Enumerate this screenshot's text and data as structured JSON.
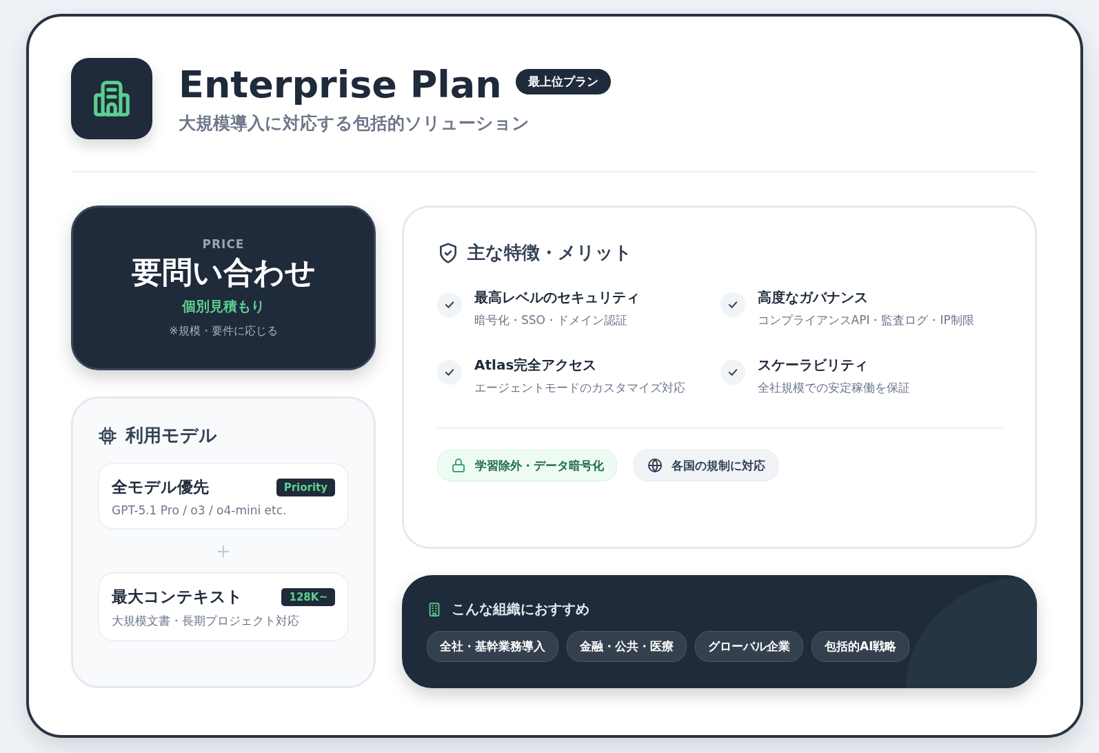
{
  "header": {
    "title": "Enterprise Plan",
    "badge": "最上位プラン",
    "subtitle": "大規模導入に対応する包括的ソリューション"
  },
  "price": {
    "label": "PRICE",
    "value": "要問い合わせ",
    "note": "個別見積もり",
    "subnote": "※規模・要件に応じる"
  },
  "models": {
    "title": "利用モデル",
    "separator": "+",
    "items": [
      {
        "name": "全モデル優先",
        "tag": "Priority",
        "desc": "GPT-5.1 Pro / o3 / o4-mini etc."
      },
      {
        "name": "最大コンテキスト",
        "tag": "128K~",
        "desc": "大規模文書・長期プロジェクト対応"
      }
    ]
  },
  "features": {
    "title": "主な特徴・メリット",
    "items": [
      {
        "title": "最高レベルのセキュリティ",
        "desc": "暗号化・SSO・ドメイン認証"
      },
      {
        "title": "高度なガバナンス",
        "desc": "コンプライアンスAPI・監査ログ・IP制限"
      },
      {
        "title": "Atlas完全アクセス",
        "desc": "エージェントモードのカスタマイズ対応"
      },
      {
        "title": "スケーラビリティ",
        "desc": "全社規模での安定稼働を保証"
      }
    ],
    "tags": [
      {
        "label": "学習除外・データ暗号化",
        "kind": "lock"
      },
      {
        "label": "各国の規制に対応",
        "kind": "globe"
      }
    ]
  },
  "recommend": {
    "title": "こんな組織におすすめ",
    "tags": [
      "全社・基幹業務導入",
      "金融・公共・医療",
      "グローバル企業",
      "包括的AI戦略"
    ]
  }
}
